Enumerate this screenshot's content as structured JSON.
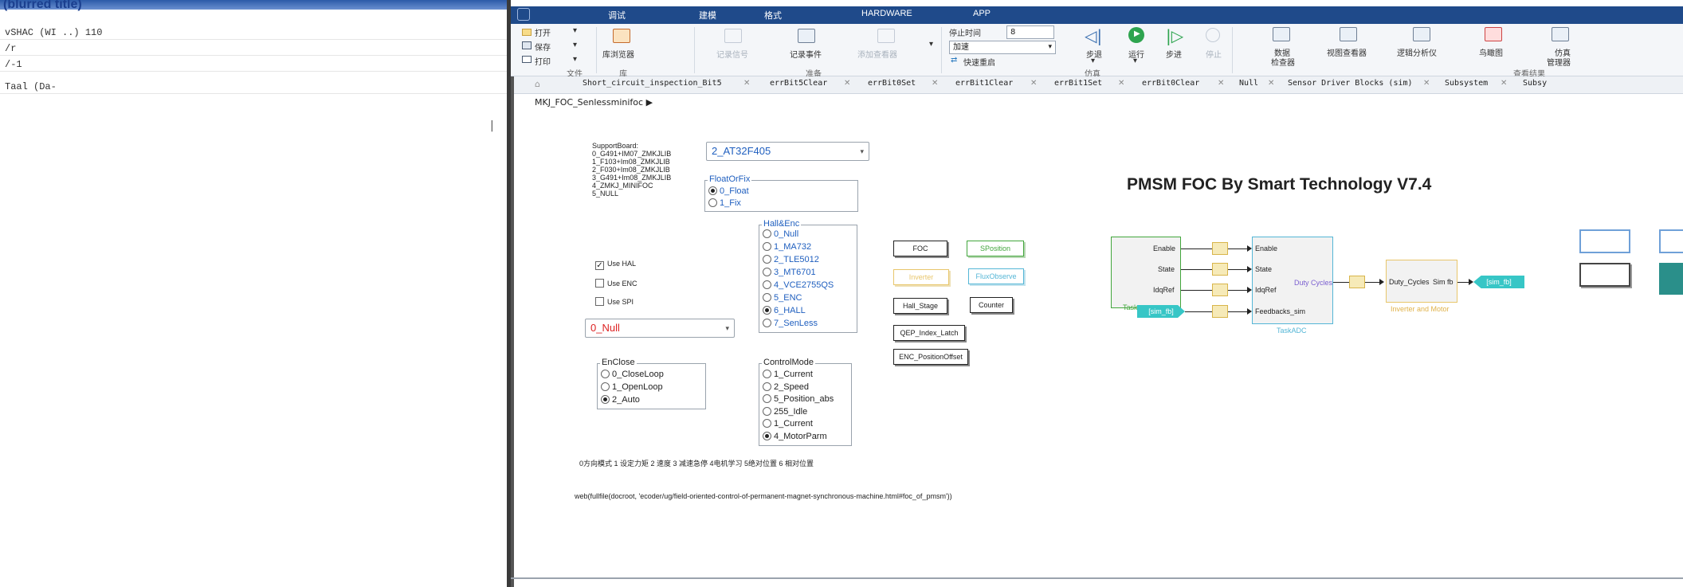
{
  "left_window": {
    "top_text": "(blurred title)",
    "rows": [
      "vSHAC (WI ..) 110",
      "/r",
      "/-1"
    ],
    "row4": "Taal (Da-",
    "scroll_mark": "|"
  },
  "menubar": {
    "items": [
      "调试",
      "建模",
      "格式",
      "HARDWARE",
      "APP"
    ]
  },
  "toolbar": {
    "file": {
      "open": "打开",
      "save": "保存",
      "print": "打印",
      "section": "文件"
    },
    "library": {
      "browser": "库浏览器",
      "section": "库"
    },
    "prepare": {
      "log_signal": "记录信号",
      "log_event": "记录事件",
      "add_viewer": "添加查看器",
      "section": "准备"
    },
    "stop_time": {
      "label": "停止时间",
      "value": "8"
    },
    "mode": {
      "value": "加速",
      "fast_restart": "快速重启"
    },
    "simulate": {
      "step_back": "步退",
      "run": "运行",
      "step_forward": "步进",
      "stop": "停止",
      "section": "仿真"
    },
    "review": {
      "data_inspector_1": "数据",
      "data_inspector_2": "检查器",
      "viewer": "视图查看器",
      "logic_analyzer": "逻辑分析仪",
      "bird_eye": "鸟瞰图",
      "sim_manager_1": "仿真",
      "sim_manager_2": "管理器",
      "section": "查看结果"
    }
  },
  "tabs": [
    "Short_circuit_inspection_Bit5",
    "errBit5Clear",
    "errBit0Set",
    "errBit1Clear",
    "errBit1Set",
    "errBit0Clear",
    "Null",
    "Sensor Driver Blocks (sim)",
    "Subsystem",
    "Subsy"
  ],
  "breadcrumb": "MKJ_FOC_Senlessminifoc ▶",
  "model": {
    "support_board_label": [
      "SupportBoard:",
      "0_G491+IM07_ZMKJLIB",
      "1_F103+Im08_ZMKJLIB",
      "2_F030+Im08_ZMKJLIB",
      "3_G491+Im08_ZMKJLIB",
      "4_ZMKJ_MINIFOC",
      "5_NULL"
    ],
    "board_value": "2_AT32F405",
    "float_or_fix": {
      "title": "FloatOrFix",
      "options": [
        "0_Float",
        "1_Fix"
      ],
      "selected": 0
    },
    "hall_enc": {
      "title": "Hall&Enc",
      "options": [
        "0_Null",
        "1_MA732",
        "2_TLE5012",
        "3_MT6701",
        "4_VCE2755QS",
        "5_ENC",
        "6_HALL",
        "7_SenLess"
      ],
      "selected": 6
    },
    "checks": [
      {
        "label": "Use HAL",
        "checked": true
      },
      {
        "label": "Use ENC",
        "checked": false
      },
      {
        "label": "Use SPI",
        "checked": false
      }
    ],
    "null_dropdown": "0_Null",
    "enclose": {
      "title": "EnClose",
      "options": [
        "0_CloseLoop",
        "1_OpenLoop",
        "2_Auto"
      ],
      "selected": 2
    },
    "control_mode": {
      "title": "ControlMode",
      "options": [
        "1_Current",
        "2_Speed",
        "5_Position_abs",
        "255_Idle",
        "1_Current",
        "4_MotorParm"
      ],
      "selected": 5
    },
    "mode_note": "0方向模式 1 设定力矩 2 速度 3 减速急停 4电机学习 5绝对位置 6 相对位置",
    "web_link": "web(fullfile(docroot, 'ecoder/ug/field-oriented-control-of-permanent-magnet-synchronous-machine.html#foc_of_pmsm'))",
    "blocks": {
      "foc": "FOC",
      "sposition": "SPosition",
      "inverter": "Inverter",
      "flux_observe": "FluxObserve",
      "hall_stage": "Hall_Stage",
      "counter": "Counter",
      "qep_index_latch": "QEP_Index_Latch",
      "enc_position_offset": "ENC_PositionOffset"
    },
    "title": "PMSM FOC  By Smart Technology V7.4",
    "diagram": {
      "task_in_ports": [
        "Enable",
        "State",
        "IdqRef"
      ],
      "task_name": "Task",
      "task_goto": "[sim_fb]",
      "adc_ports": [
        "Enable",
        "State",
        "IdqRef",
        "Feedbacks_sim"
      ],
      "adc_out": "Duty Cycles",
      "adc_name": "TaskADC",
      "inv_in": "Duty_Cycles",
      "inv_out": "Sim fb",
      "inv_name": "Inverter and Motor",
      "goto_out": "[sim_fb]"
    }
  },
  "colors": {
    "menubar": "#1f4a8a",
    "accent_blue": "#1f5fbf",
    "green": "#42a63c",
    "cyan": "#37c6c6",
    "gold": "#d8b54a"
  }
}
